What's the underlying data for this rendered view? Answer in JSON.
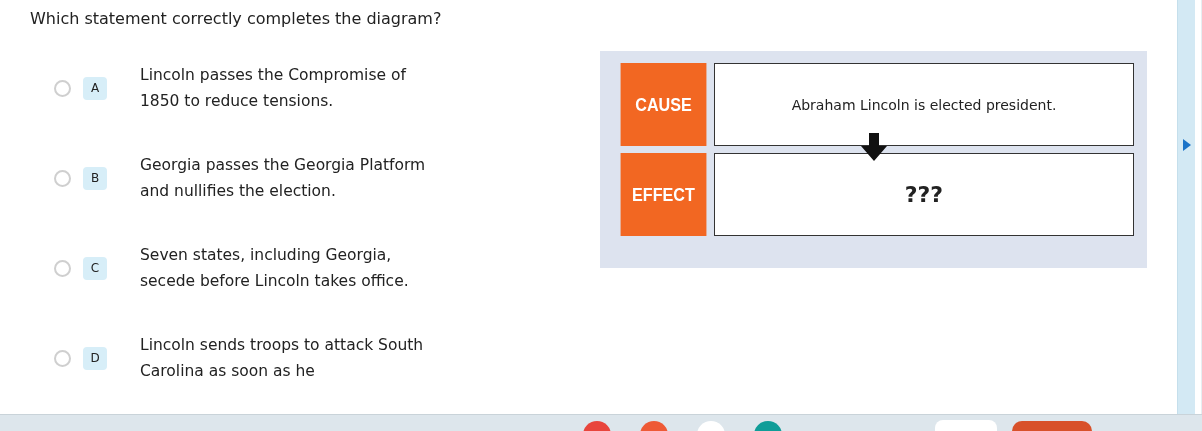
{
  "question": "Which statement correctly completes the diagram?",
  "options": [
    {
      "letter": "A",
      "text": "Lincoln passes the Compromise of 1850 to reduce tensions.",
      "selected": false
    },
    {
      "letter": "B",
      "text": "Georgia passes the Georgia Platform and nullifies the election.",
      "selected": false
    },
    {
      "letter": "C",
      "text": "Seven states, including Georgia, secede before Lincoln takes office.",
      "selected": false
    },
    {
      "letter": "D",
      "text": "Lincoln sends troops to attack South Carolina as soon as he",
      "selected": false
    }
  ],
  "diagram": {
    "rows": [
      {
        "label": "CAUSE",
        "text": "Abraham Lincoln is elected president.",
        "kind": "statement"
      },
      {
        "label": "EFFECT",
        "text": "???",
        "kind": "unknown"
      }
    ]
  }
}
